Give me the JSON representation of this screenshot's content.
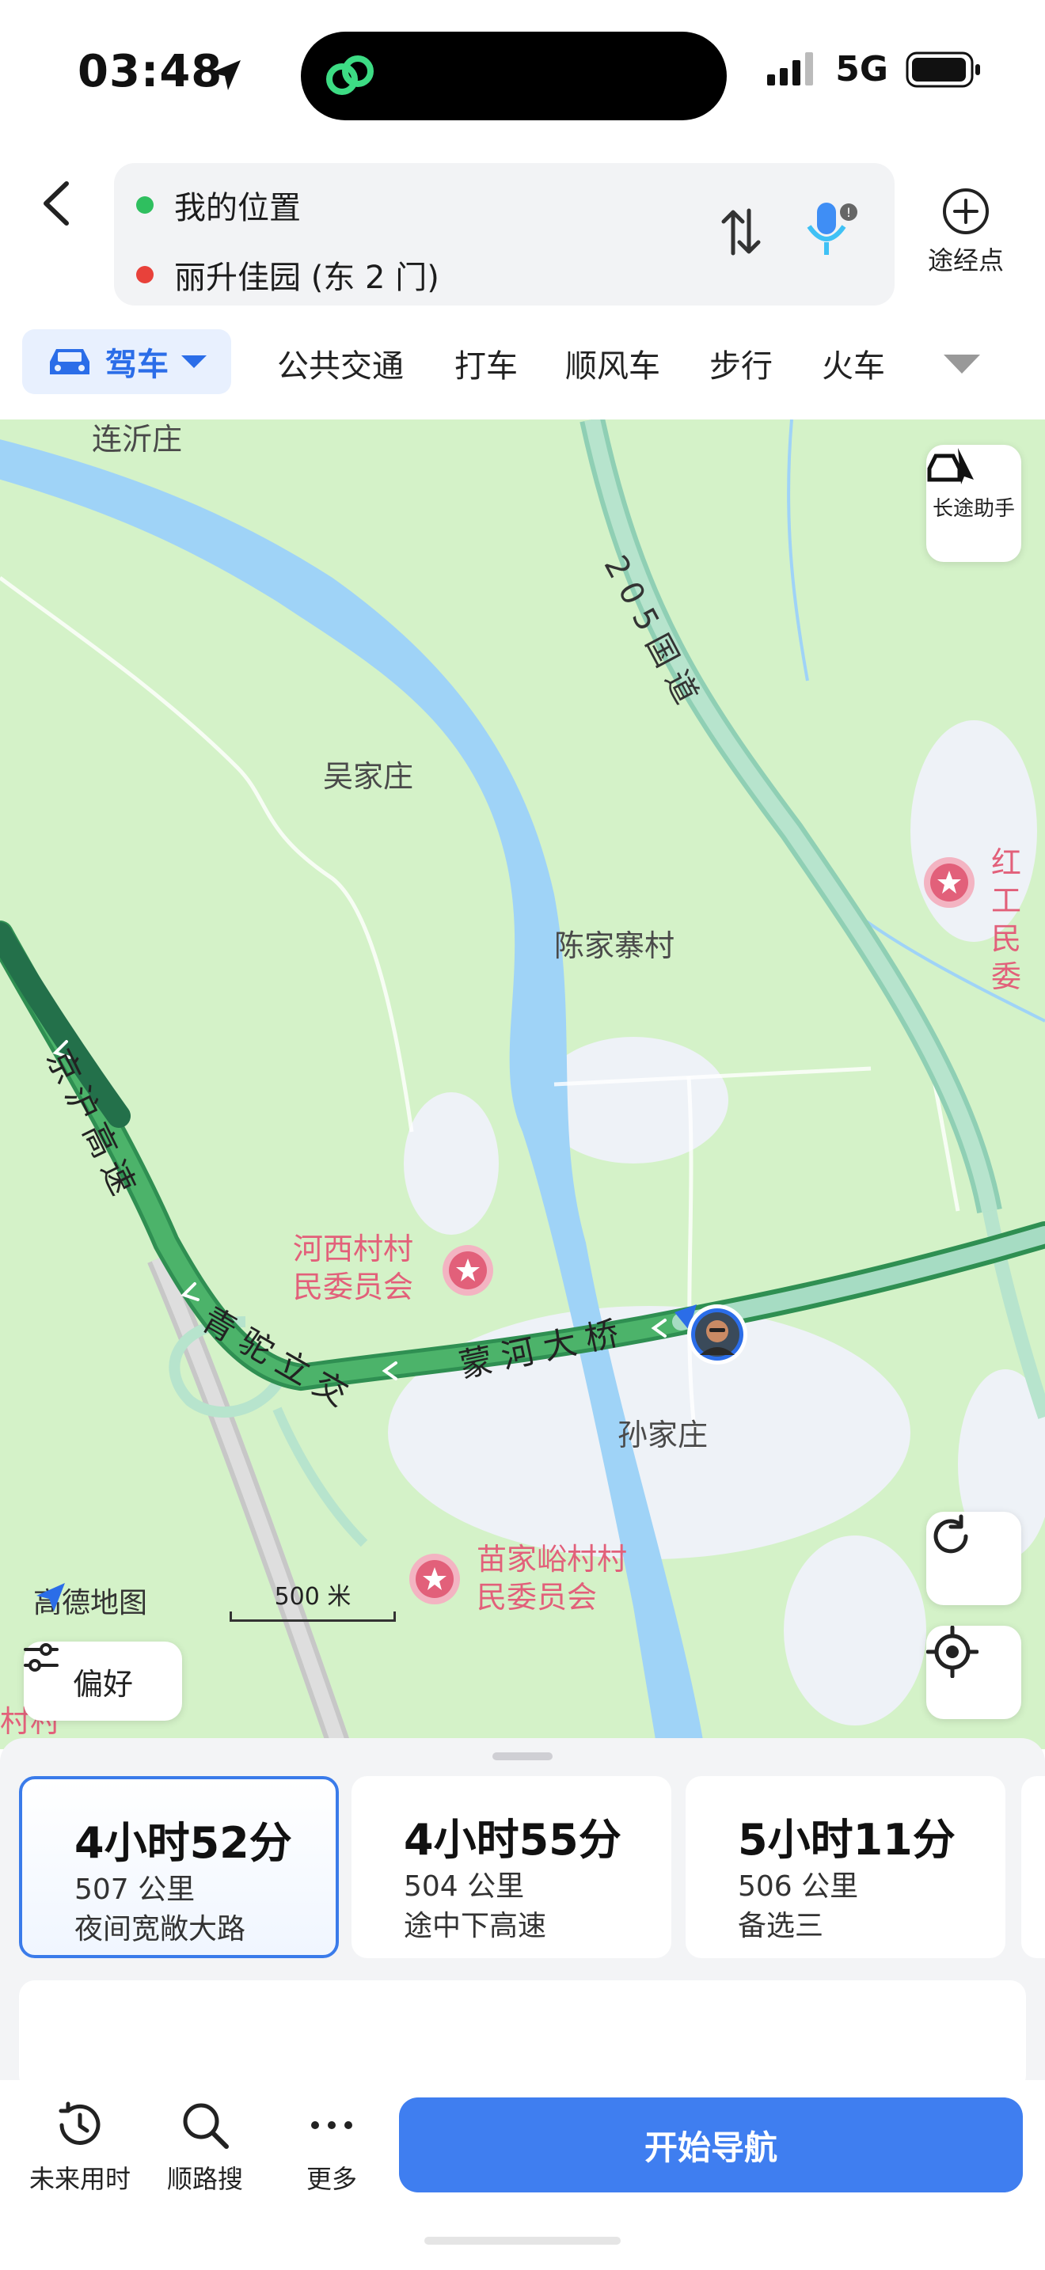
{
  "status": {
    "time": "03:48",
    "network": "5G"
  },
  "route": {
    "origin": "我的位置",
    "destination": "丽升佳园 (东 2 门)",
    "waypoint_label": "途经点"
  },
  "modes": {
    "active": "驾车",
    "tabs": [
      "公共交通",
      "打车",
      "顺风车",
      "步行",
      "火车"
    ]
  },
  "map": {
    "places": {
      "lianyizhuang": "连沂庄",
      "wujiazhuang": "吴家庄",
      "chenjiazhaicun": "陈家寨村",
      "sunjiazhuang": "孙家庄",
      "hong": "红工",
      "min": "民委",
      "cunzhuang": "村村"
    },
    "roads": {
      "g205": "205国道",
      "jinghu": "京沪高速",
      "qinglu": "青驼立交",
      "menghe": "蒙河大桥"
    },
    "pois": {
      "hexi_line1": "河西村村",
      "hexi_line2": "民委员会",
      "miaojia_line1": "苗家峪村村",
      "miaojia_line2": "民委员会"
    },
    "brand": "高德地图",
    "scale": "500 米",
    "long_trip_label": "长途助手",
    "preference_label": "偏好"
  },
  "routes": [
    {
      "duration": "4小时52分",
      "distance": "507 公里",
      "tag": "夜间宽敞大路"
    },
    {
      "duration": "4小时55分",
      "distance": "504 公里",
      "tag": "途中下高速"
    },
    {
      "duration": "5小时11分",
      "distance": "506 公里",
      "tag": "备选三"
    }
  ],
  "bottom": {
    "future": "未来用时",
    "along": "顺路搜",
    "more": "更多",
    "start_nav": "开始导航"
  },
  "colors": {
    "accent": "#3f7ef0",
    "route": "#4cb36a",
    "river": "#9fd3f7",
    "map_bg": "#d4f2c8",
    "poi": "#e2607a"
  }
}
